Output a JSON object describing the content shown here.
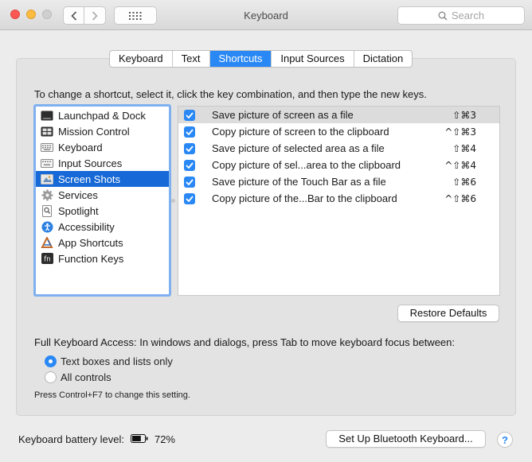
{
  "window": {
    "title": "Keyboard"
  },
  "toolbar": {
    "search_placeholder": "Search"
  },
  "tabs": [
    {
      "label": "Keyboard",
      "active": false
    },
    {
      "label": "Text",
      "active": false
    },
    {
      "label": "Shortcuts",
      "active": true
    },
    {
      "label": "Input Sources",
      "active": false
    },
    {
      "label": "Dictation",
      "active": false
    }
  ],
  "instructions": "To change a shortcut, select it, click the key combination, and then type the new keys.",
  "categories": [
    {
      "label": "Launchpad & Dock",
      "icon": "launchpad-icon"
    },
    {
      "label": "Mission Control",
      "icon": "mission-control-icon"
    },
    {
      "label": "Keyboard",
      "icon": "keyboard-icon"
    },
    {
      "label": "Input Sources",
      "icon": "input-sources-icon"
    },
    {
      "label": "Screen Shots",
      "icon": "screenshot-icon",
      "selected": true
    },
    {
      "label": "Services",
      "icon": "gear-icon"
    },
    {
      "label": "Spotlight",
      "icon": "spotlight-icon"
    },
    {
      "label": "Accessibility",
      "icon": "accessibility-icon"
    },
    {
      "label": "App Shortcuts",
      "icon": "app-shortcuts-icon"
    },
    {
      "label": "Function Keys",
      "icon": "fn-key-icon"
    }
  ],
  "shortcuts": [
    {
      "label": "Save picture of screen as a file",
      "keys": "⇧⌘3",
      "checked": true
    },
    {
      "label": "Copy picture of screen to the clipboard",
      "keys": "^⇧⌘3",
      "checked": true
    },
    {
      "label": "Save picture of selected area as a file",
      "keys": "⇧⌘4",
      "checked": true
    },
    {
      "label": "Copy picture of sel...area to the clipboard",
      "keys": "^⇧⌘4",
      "checked": true
    },
    {
      "label": "Save picture of the Touch Bar as a file",
      "keys": "⇧⌘6",
      "checked": true
    },
    {
      "label": "Copy picture of the...Bar to the clipboard",
      "keys": "^⇧⌘6",
      "checked": true
    }
  ],
  "restore_defaults": "Restore Defaults",
  "full_keyboard_access": {
    "label": "Full Keyboard Access: In windows and dialogs, press Tab to move keyboard focus between:",
    "options": [
      {
        "label": "Text boxes and lists only",
        "selected": true
      },
      {
        "label": "All controls",
        "selected": false
      }
    ],
    "hint": "Press Control+F7 to change this setting."
  },
  "battery": {
    "label": "Keyboard battery level:",
    "value": "72%",
    "level": 0.72
  },
  "bluetooth_button": "Set Up Bluetooth Keyboard...",
  "help": "?"
}
